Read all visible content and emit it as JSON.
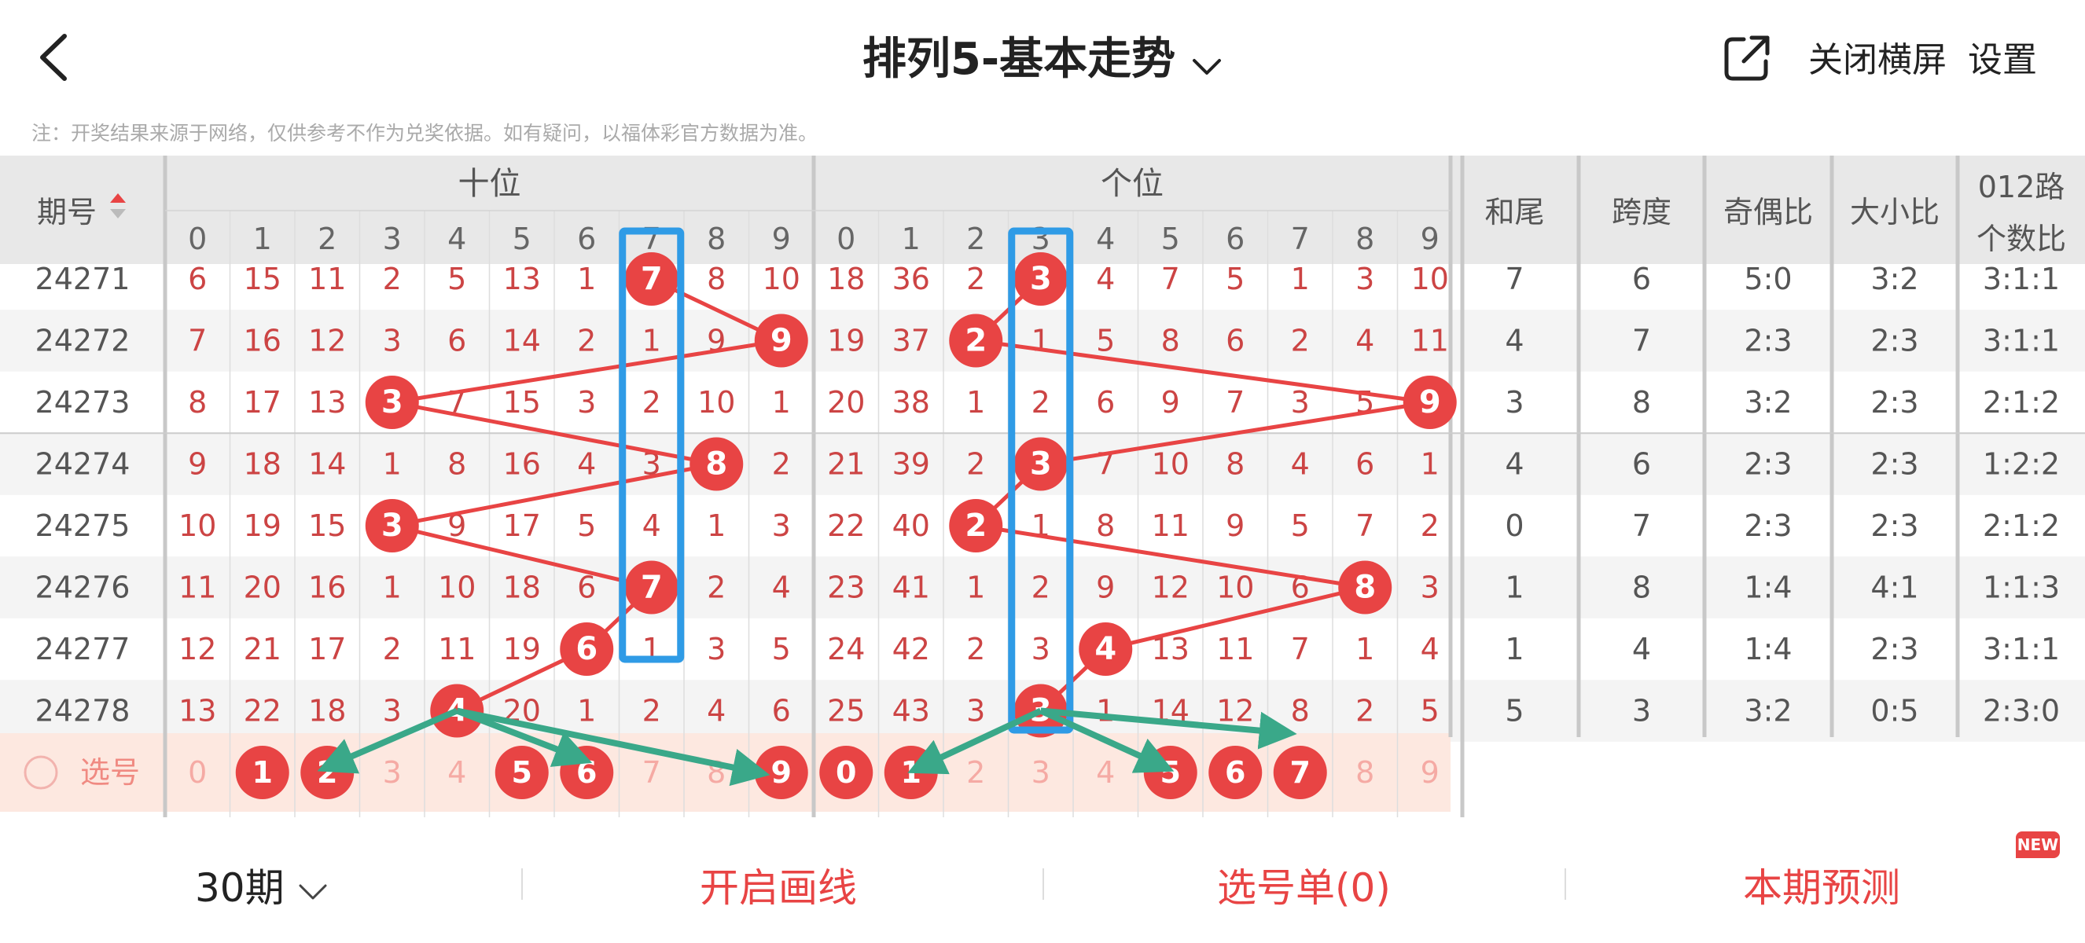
{
  "header": {
    "title": "排列5-基本走势",
    "close_landscape": "关闭横屏",
    "settings": "设置"
  },
  "note": "注：开奖结果来源于网络，仅供参考不作为兑奖依据。如有疑问，以福体彩官方数据为准。",
  "table": {
    "period_header": "期号",
    "tens_header": "十位",
    "units_header": "个位",
    "digits": [
      "0",
      "1",
      "2",
      "3",
      "4",
      "5",
      "6",
      "7",
      "8",
      "9"
    ],
    "sum_tail_header": "和尾",
    "span_header": "跨度",
    "odd_even_header": "奇偶比",
    "big_small_header": "大小比",
    "route012_header_line1": "012路",
    "route012_header_line2": "个数比",
    "rows": [
      {
        "period": "24271",
        "tens": [
          "6",
          "15",
          "11",
          "2",
          "5",
          "13",
          "1",
          "7",
          "8",
          "10"
        ],
        "units": [
          "18",
          "36",
          "2",
          "3",
          "4",
          "7",
          "5",
          "1",
          "3",
          "10"
        ],
        "tens_hit": 7,
        "units_hit": 3,
        "sum_tail": "7",
        "span": "6",
        "odd_even": "5:0",
        "big_small": "3:2",
        "route012": "3:1:1"
      },
      {
        "period": "24272",
        "tens": [
          "7",
          "16",
          "12",
          "3",
          "6",
          "14",
          "2",
          "1",
          "9",
          "9"
        ],
        "units": [
          "19",
          "37",
          "2",
          "1",
          "5",
          "8",
          "6",
          "2",
          "4",
          "11"
        ],
        "tens_hit": 9,
        "units_hit": 2,
        "sum_tail": "4",
        "span": "7",
        "odd_even": "2:3",
        "big_small": "2:3",
        "route012": "3:1:1"
      },
      {
        "period": "24273",
        "tens": [
          "8",
          "17",
          "13",
          "3",
          "7",
          "15",
          "3",
          "2",
          "10",
          "1"
        ],
        "units": [
          "20",
          "38",
          "1",
          "2",
          "6",
          "9",
          "7",
          "3",
          "5",
          "9"
        ],
        "tens_hit": 3,
        "units_hit": 9,
        "sum_tail": "3",
        "span": "8",
        "odd_even": "3:2",
        "big_small": "2:3",
        "route012": "2:1:2"
      },
      {
        "period": "24274",
        "tens": [
          "9",
          "18",
          "14",
          "1",
          "8",
          "16",
          "4",
          "3",
          "8",
          "2"
        ],
        "units": [
          "21",
          "39",
          "2",
          "3",
          "7",
          "10",
          "8",
          "4",
          "6",
          "1"
        ],
        "tens_hit": 8,
        "units_hit": 3,
        "sum_tail": "4",
        "span": "6",
        "odd_even": "2:3",
        "big_small": "2:3",
        "route012": "1:2:2"
      },
      {
        "period": "24275",
        "tens": [
          "10",
          "19",
          "15",
          "3",
          "9",
          "17",
          "5",
          "4",
          "1",
          "3"
        ],
        "units": [
          "22",
          "40",
          "2",
          "1",
          "8",
          "11",
          "9",
          "5",
          "7",
          "2"
        ],
        "tens_hit": 3,
        "units_hit": 2,
        "sum_tail": "0",
        "span": "7",
        "odd_even": "2:3",
        "big_small": "2:3",
        "route012": "2:1:2"
      },
      {
        "period": "24276",
        "tens": [
          "11",
          "20",
          "16",
          "1",
          "10",
          "18",
          "6",
          "7",
          "2",
          "4"
        ],
        "units": [
          "23",
          "41",
          "1",
          "2",
          "9",
          "12",
          "10",
          "6",
          "8",
          "3"
        ],
        "tens_hit": 7,
        "units_hit": 8,
        "sum_tail": "1",
        "span": "8",
        "odd_even": "1:4",
        "big_small": "4:1",
        "route012": "1:1:3"
      },
      {
        "period": "24277",
        "tens": [
          "12",
          "21",
          "17",
          "2",
          "11",
          "19",
          "6",
          "1",
          "3",
          "5"
        ],
        "units": [
          "24",
          "42",
          "2",
          "3",
          "4",
          "13",
          "11",
          "7",
          "1",
          "4"
        ],
        "tens_hit": 6,
        "units_hit": 4,
        "sum_tail": "1",
        "span": "4",
        "odd_even": "1:4",
        "big_small": "2:3",
        "route012": "3:1:1"
      },
      {
        "period": "24278",
        "tens": [
          "13",
          "22",
          "18",
          "3",
          "4",
          "20",
          "1",
          "2",
          "4",
          "6"
        ],
        "units": [
          "25",
          "43",
          "3",
          "3",
          "1",
          "14",
          "12",
          "8",
          "2",
          "5"
        ],
        "tens_hit": 4,
        "units_hit": 3,
        "sum_tail": "5",
        "span": "3",
        "odd_even": "3:2",
        "big_small": "0:5",
        "route012": "2:3:0"
      }
    ],
    "pick_label": "选号",
    "pick_tens": [
      "0",
      "1",
      "2",
      "3",
      "4",
      "5",
      "6",
      "7",
      "8",
      "9"
    ],
    "pick_tens_selected": [
      1,
      2,
      5,
      6,
      9
    ],
    "pick_units": [
      "0",
      "1",
      "2",
      "3",
      "4",
      "5",
      "6",
      "7",
      "8",
      "9"
    ],
    "pick_units_selected": [
      0,
      1,
      5,
      6,
      7
    ]
  },
  "bottom": {
    "periods": "30期",
    "draw_lines": "开启画线",
    "pick_list": "选号单(0)",
    "prediction": "本期预测",
    "new_badge": "NEW"
  },
  "colors": {
    "red": "#e84444",
    "blue_highlight": "#2f9be6",
    "green_arrow": "#3aa889",
    "header_bg": "#e8e8e8",
    "pick_row_bg": "#fde8e0"
  },
  "icons": {
    "back": "chevron-left-icon",
    "title_dropdown": "chevron-down-icon",
    "share": "share-external-icon",
    "sort": "sort-icon",
    "periods_dropdown": "chevron-down-icon"
  }
}
